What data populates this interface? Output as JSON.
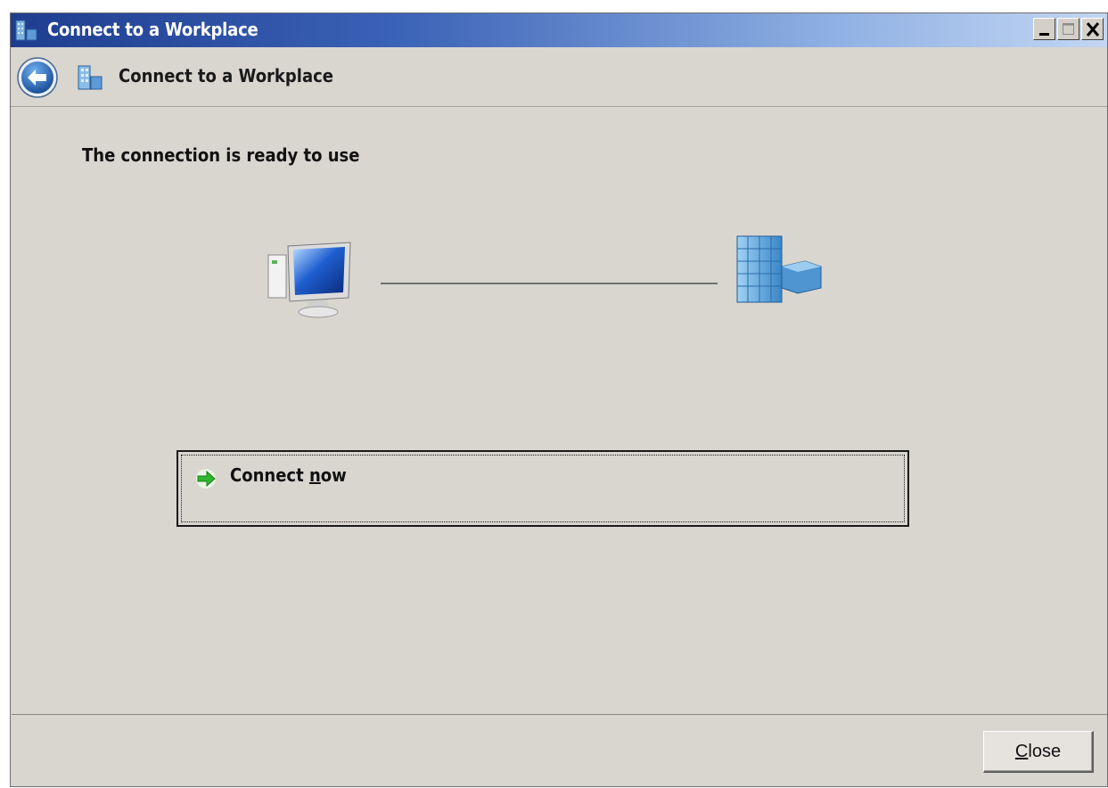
{
  "window": {
    "title": "Connect to a Workplace",
    "controls": {
      "minimize_icon": "minimize-icon",
      "maximize_icon": "maximize-icon",
      "close_icon": "close-x-icon"
    }
  },
  "nav": {
    "back_icon": "back-arrow-icon",
    "title": "Connect to a Workplace",
    "title_icon": "workplace-building-icon"
  },
  "main": {
    "heading": "The connection is ready to use",
    "diagram": {
      "left_icon": "computer-icon",
      "right_icon": "workplace-building-icon"
    },
    "connect_option": {
      "icon": "green-arrow-icon",
      "label_prefix": "Connect ",
      "label_accel": "n",
      "label_suffix": "ow"
    }
  },
  "footer": {
    "close_accel": "C",
    "close_rest": "lose"
  },
  "colors": {
    "titlebar_start": "#1f3d8f",
    "titlebar_end": "#c3d6f2",
    "dialog_bg": "#d9d6cf",
    "arrow_green": "#2fb52f",
    "back_button_blue": "#2d6fc0"
  }
}
